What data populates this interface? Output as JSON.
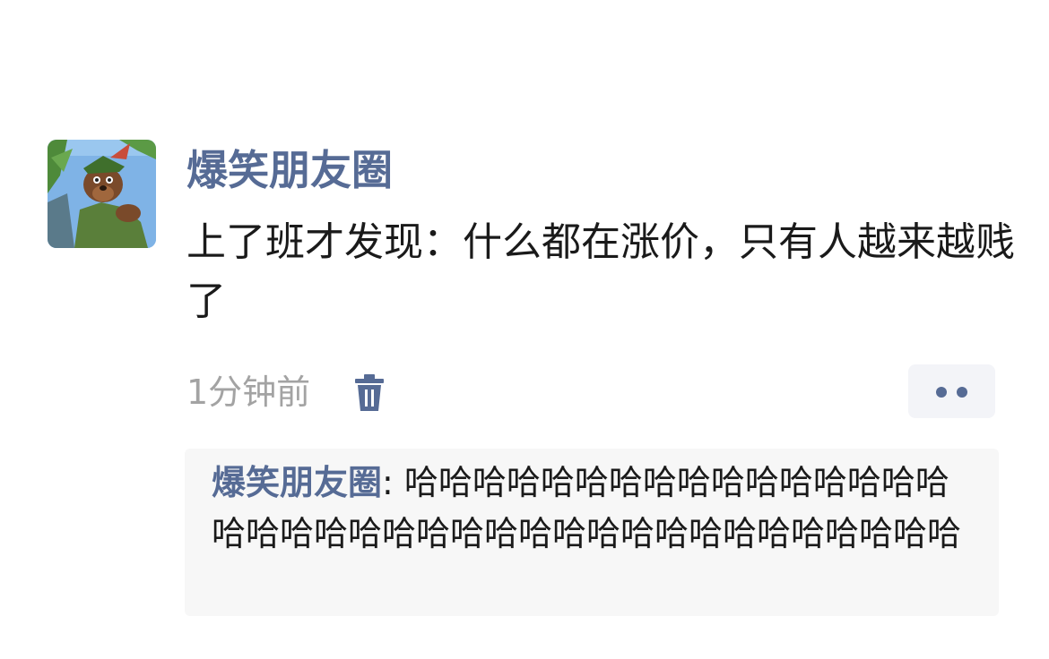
{
  "post": {
    "author": "爆笑朋友圈",
    "text": "上了班才发现：什么都在涨价，只有人越来越贱了",
    "time": "1分钟前"
  },
  "actions": {
    "trash_icon": "trash-icon",
    "more_icon": "more-dots-icon"
  },
  "comments": [
    {
      "author": "爆笑朋友圈",
      "separator": ": ",
      "text": "哈哈哈哈哈哈哈哈哈哈哈哈哈哈哈哈哈哈哈哈哈哈哈哈哈哈哈哈哈哈哈哈哈哈哈哈哈哈"
    }
  ],
  "colors": {
    "name_accent": "#566b95",
    "timestamp": "#a3a3a3",
    "comment_bg": "#f7f7f7"
  }
}
